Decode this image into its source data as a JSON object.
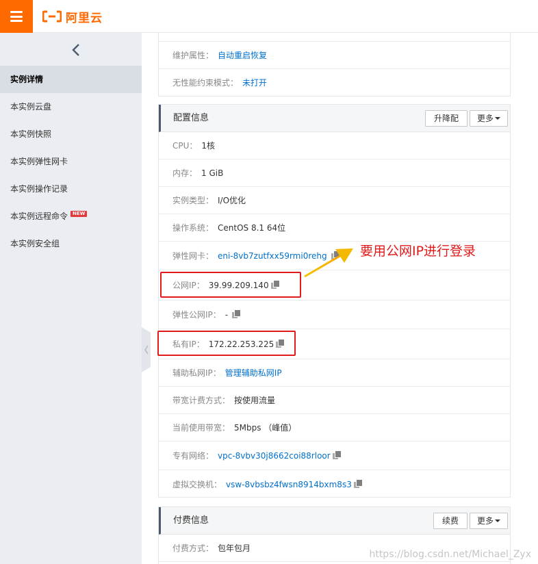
{
  "header": {
    "logo_text": "阿里云",
    "brand_color": "#ff6a00"
  },
  "sidebar": {
    "items": [
      {
        "label": "实例详情",
        "active": true
      },
      {
        "label": "本实例云盘"
      },
      {
        "label": "本实例快照"
      },
      {
        "label": "本实例弹性网卡"
      },
      {
        "label": "本实例操作记录"
      },
      {
        "label": "本实例远程命令",
        "badge": "NEW"
      },
      {
        "label": "本实例安全组"
      }
    ]
  },
  "top_panel": {
    "rows": [
      {
        "label": "维护属性：",
        "value": "自动重启恢复"
      },
      {
        "label": "无性能约束模式：",
        "value": "未打开"
      }
    ]
  },
  "config_panel": {
    "title": "配置信息",
    "upgrade_button": "升降配",
    "more_button": "更多",
    "rows": [
      {
        "label": "CPU：",
        "value": "1核"
      },
      {
        "label": "内存：",
        "value": "1 GiB"
      },
      {
        "label": "实例类型：",
        "value": "I/O优化"
      },
      {
        "label": "操作系统：",
        "value": "CentOS 8.1 64位"
      },
      {
        "label": "弹性网卡：",
        "value": "eni-8vb7zutfxx59rmi0rehg"
      },
      {
        "label": "公网IP：",
        "value": "39.99.209.140"
      },
      {
        "label": "弹性公网IP：",
        "value": "-"
      },
      {
        "label": "私有IP：",
        "value": "172.22.253.225"
      },
      {
        "label": "辅助私网IP：",
        "value": "管理辅助私网IP"
      },
      {
        "label": "带宽计费方式：",
        "value": "按使用流量"
      },
      {
        "label": "当前使用带宽：",
        "value": "5Mbps （峰值）"
      },
      {
        "label": "专有网络：",
        "value": "vpc-8vbv30j8662coi88rloor"
      },
      {
        "label": "虚拟交换机：",
        "value": "vsw-8vbsbz4fwsn8914bxm8s3"
      }
    ]
  },
  "billing_panel": {
    "title": "付费信息",
    "renew_button": "续费",
    "more_button": "更多",
    "rows": [
      {
        "label": "付费方式：",
        "value": "包年包月"
      }
    ]
  },
  "annotation": {
    "text": "要用公网IP进行登录",
    "color": "#e0191a"
  },
  "watermark": "https://blog.csdn.net/Michael_Zyx"
}
